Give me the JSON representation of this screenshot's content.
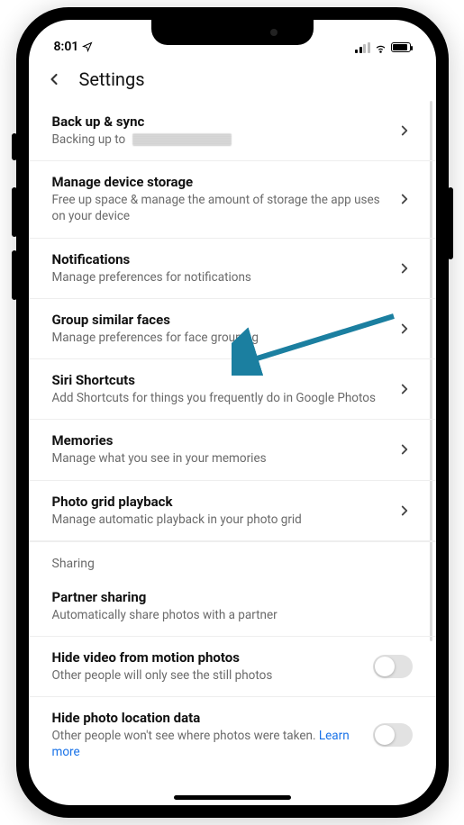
{
  "status": {
    "time": "8:01"
  },
  "header": {
    "title": "Settings"
  },
  "rows": {
    "backup": {
      "title": "Back up & sync",
      "sub": "Backing up to "
    },
    "storage": {
      "title": "Manage device storage",
      "sub": "Free up space & manage the amount of storage the app uses on your device"
    },
    "notifications": {
      "title": "Notifications",
      "sub": "Manage preferences for notifications"
    },
    "faces": {
      "title": "Group similar faces",
      "sub": "Manage preferences for face grouping"
    },
    "siri": {
      "title": "Siri Shortcuts",
      "sub": "Add Shortcuts for things you frequently do in Google Photos"
    },
    "memories": {
      "title": "Memories",
      "sub": "Manage what you see in your memories"
    },
    "playback": {
      "title": "Photo grid playback",
      "sub": "Manage automatic playback in your photo grid"
    },
    "partner": {
      "title": "Partner sharing",
      "sub": "Automatically share photos with a partner"
    },
    "hidevideo": {
      "title": "Hide video from motion photos",
      "sub": "Other people will only see the still photos"
    },
    "hidelocation": {
      "title": "Hide photo location data",
      "sub": "Other people won't see where photos were taken. ",
      "link": "Learn more"
    }
  },
  "sections": {
    "sharing": "Sharing"
  }
}
